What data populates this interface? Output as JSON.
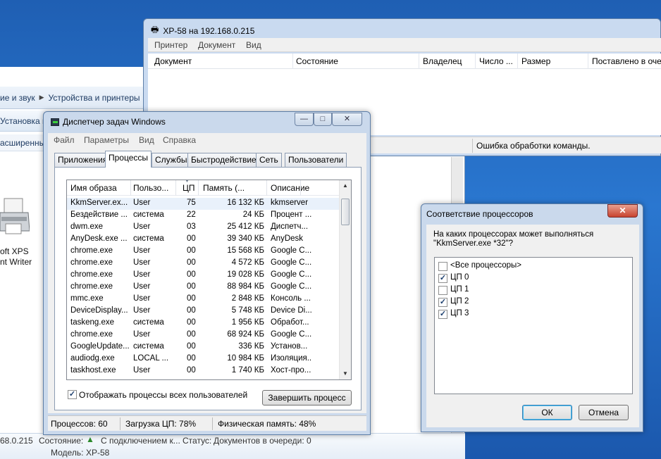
{
  "explorer": {
    "breadcrumb": [
      "ие и звук",
      "Устройства и принтеры"
    ],
    "cmd_add": "Установка п",
    "cmd_more": "асширенные",
    "printer_label_1": "oft XPS",
    "printer_label_2": "nt Writer",
    "details": {
      "ip": "68.0.215",
      "state_label": "Состояние:",
      "state_value": "С подключением к...",
      "status_label": "Статус:",
      "status_value": "Документов в очереди: 0",
      "model_label": "Модель:",
      "model_value": "XP-58"
    }
  },
  "queue": {
    "title": "XP-58 на 192.168.0.215",
    "menu": [
      "Принтер",
      "Документ",
      "Вид"
    ],
    "columns": [
      "Документ",
      "Состояние",
      "Владелец",
      "Число ...",
      "Размер",
      "Поставлено в оче"
    ],
    "status": "Ошибка обработки команды."
  },
  "taskmgr": {
    "title": "Диспетчер задач Windows",
    "menu": [
      "Файл",
      "Параметры",
      "Вид",
      "Справка"
    ],
    "tabs": [
      "Приложения",
      "Процессы",
      "Службы",
      "Быстродействие",
      "Сеть",
      "Пользователи"
    ],
    "columns": [
      "Имя образа",
      "Пользо...",
      "ЦП",
      "Память (...",
      "Описание"
    ],
    "rows": [
      [
        "KkmServer.ex...",
        "User",
        "75",
        "16 132 КБ",
        "kkmserver"
      ],
      [
        "Бездействие ...",
        "система",
        "22",
        "24 КБ",
        "Процент ..."
      ],
      [
        "dwm.exe",
        "User",
        "03",
        "25 412 КБ",
        "Диспетч..."
      ],
      [
        "AnyDesk.exe ...",
        "система",
        "00",
        "39 340 КБ",
        "AnyDesk"
      ],
      [
        "chrome.exe",
        "User",
        "00",
        "15 568 КБ",
        "Google C..."
      ],
      [
        "chrome.exe",
        "User",
        "00",
        "4 572 КБ",
        "Google C..."
      ],
      [
        "chrome.exe",
        "User",
        "00",
        "19 028 КБ",
        "Google C..."
      ],
      [
        "chrome.exe",
        "User",
        "00",
        "88 984 КБ",
        "Google C..."
      ],
      [
        "mmc.exe",
        "User",
        "00",
        "2 848 КБ",
        "Консоль ..."
      ],
      [
        "DeviceDisplay...",
        "User",
        "00",
        "5 748 КБ",
        "Device Di..."
      ],
      [
        "taskeng.exe",
        "система",
        "00",
        "1 956 КБ",
        "Обработ..."
      ],
      [
        "chrome.exe",
        "User",
        "00",
        "68 924 КБ",
        "Google C..."
      ],
      [
        "GoogleUpdate...",
        "система",
        "00",
        "336 КБ",
        "Установ..."
      ],
      [
        "audiodg.exe",
        "LOCAL ...",
        "00",
        "10 984 КБ",
        "Изоляция..."
      ],
      [
        "taskhost.exe",
        "User",
        "00",
        "1 740 КБ",
        "Хост-про..."
      ]
    ],
    "show_all_label": "Отображать процессы всех пользователей",
    "show_all_checked": true,
    "end_process": "Завершить процесс",
    "status": [
      "Процессов: 60",
      "Загрузка ЦП: 78%",
      "Физическая память: 48%"
    ]
  },
  "affinity": {
    "title": "Соответствие процессоров",
    "question": "На каких процессорах может выполняться \"KkmServer.exe *32\"?",
    "items": [
      {
        "label": "<Все процессоры>",
        "checked": false
      },
      {
        "label": "ЦП 0",
        "checked": true
      },
      {
        "label": "ЦП 1",
        "checked": false
      },
      {
        "label": "ЦП 2",
        "checked": true
      },
      {
        "label": "ЦП 3",
        "checked": true
      }
    ],
    "ok": "ОК",
    "cancel": "Отмена"
  }
}
